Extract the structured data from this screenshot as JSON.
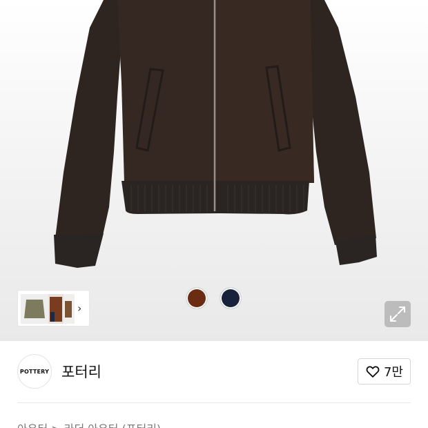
{
  "product": {
    "image_alt_colors": [
      "#3a2b24",
      "#2b2320"
    ],
    "color_options": [
      {
        "name": "brown",
        "hex": "#6b2d12"
      },
      {
        "name": "navy",
        "hex": "#18223a"
      }
    ],
    "thumbnail_next_icon": "chevron-right-icon",
    "expand_icon": "expand-icon"
  },
  "brand": {
    "logo_text": "POTTERY",
    "name": "포터리",
    "like_icon": "heart-icon",
    "like_count": "7만"
  },
  "breadcrumb": {
    "text": "아우터 > 라더 아우터 (포터리)"
  }
}
